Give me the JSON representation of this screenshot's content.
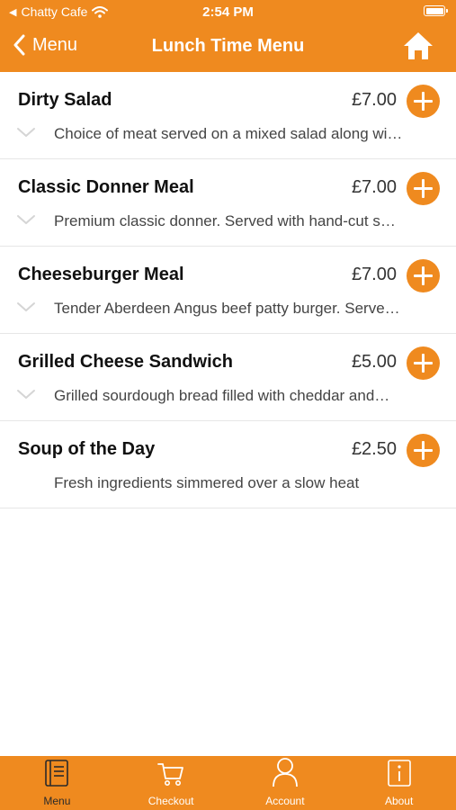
{
  "status_bar": {
    "back_app": "Chatty Cafe",
    "time": "2:54 PM"
  },
  "nav": {
    "back_label": "Menu",
    "title": "Lunch Time Menu"
  },
  "items": [
    {
      "name": "Dirty Salad",
      "price": "£7.00",
      "description": "Choice of meat served on a mixed salad along wi…",
      "expandable": true
    },
    {
      "name": "Classic Donner Meal",
      "price": "£7.00",
      "description": "Premium classic donner. Served with hand-cut s…",
      "expandable": true
    },
    {
      "name": "Cheeseburger Meal",
      "price": "£7.00",
      "description": "Tender Aberdeen Angus beef patty burger. Serve…",
      "expandable": true
    },
    {
      "name": "Grilled Cheese Sandwich",
      "price": "£5.00",
      "description": "Grilled sourdough bread filled with cheddar and…",
      "expandable": true
    },
    {
      "name": "Soup of the Day",
      "price": "£2.50",
      "description": "Fresh ingredients simmered over a slow heat",
      "expandable": false
    }
  ],
  "tabs": [
    {
      "label": "Menu",
      "icon": "menu-book-icon",
      "active": true
    },
    {
      "label": "Checkout",
      "icon": "cart-icon",
      "active": false
    },
    {
      "label": "Account",
      "icon": "person-icon",
      "active": false
    },
    {
      "label": "About",
      "icon": "info-icon",
      "active": false
    }
  ],
  "colors": {
    "accent": "#EF8A1F",
    "tab_active_label": "#2a2a2a"
  }
}
